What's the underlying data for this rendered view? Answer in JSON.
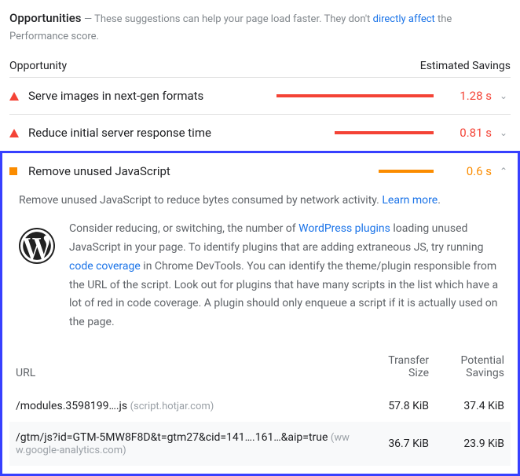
{
  "section": {
    "title": "Opportunities",
    "subtitle_prefix": "— These suggestions can help your page load faster. They don't ",
    "subtitle_link": "directly affect",
    "subtitle_suffix": " the Performance score."
  },
  "columns": {
    "left": "Opportunity",
    "right": "Estimated Savings"
  },
  "opportunities": [
    {
      "name": "Serve images in next-gen formats",
      "savings": "1.28 s",
      "color": "#f44336",
      "bar_pct": 100,
      "severity": "triangle",
      "expanded": false
    },
    {
      "name": "Reduce initial server response time",
      "savings": "0.81 s",
      "color": "#f44336",
      "bar_pct": 63,
      "severity": "triangle",
      "expanded": false
    },
    {
      "name": "Remove unused JavaScript",
      "savings": "0.6 s",
      "color": "#fb8c00",
      "bar_pct": 35,
      "severity": "square",
      "expanded": true
    }
  ],
  "detail": {
    "description_prefix": "Remove unused JavaScript to reduce bytes consumed by network activity. ",
    "description_link": "Learn more",
    "tip_parts": {
      "a": "Consider reducing, or switching, the number of ",
      "link1": "WordPress plugins",
      "b": " loading unused JavaScript in your page. To identify plugins that are adding extraneous JS, try running ",
      "link2": "code coverage",
      "c": " in Chrome DevTools. You can identify the theme/plugin responsible from the URL of the script. Look out for plugins that have many scripts in the list which have a lot of red in code coverage. A plugin should only enqueue a script if it is actually used on the page."
    },
    "table": {
      "headers": {
        "url": "URL",
        "transfer": "Transfer Size",
        "potential": "Potential Savings"
      },
      "rows": [
        {
          "url": "/modules.3598199…​.js",
          "host": "(script.hotjar.com)",
          "transfer": "57.8 KiB",
          "potential": "37.4 KiB"
        },
        {
          "url": "/gtm/js?id=GTM-5MW8F8D&t=gtm27&cid=141…​.161…​&aip=true",
          "host": "(www.google-analytics.com)",
          "transfer": "36.7 KiB",
          "potential": "23.9 KiB"
        }
      ]
    }
  }
}
